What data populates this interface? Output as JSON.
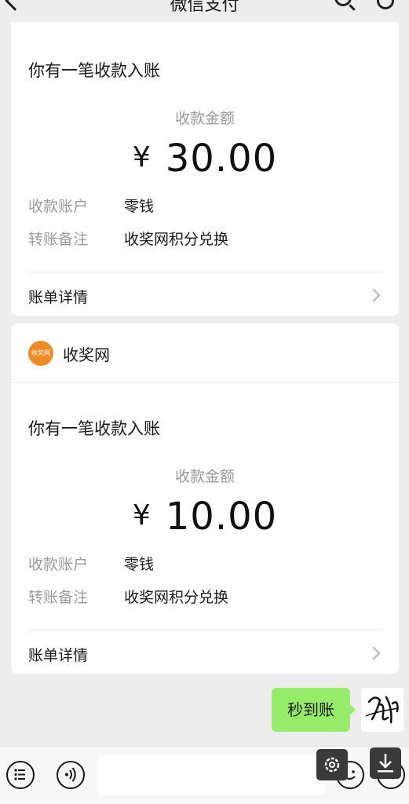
{
  "nav": {
    "title": "微信支付"
  },
  "cards": [
    {
      "notice_title": "你有一笔收款入账",
      "amount_label": "收款金额",
      "currency": "¥",
      "amount": "30.00",
      "account_key": "收款账户",
      "account_value": "零钱",
      "remark_key": "转账备注",
      "remark_value": "收奖网积分兑换",
      "detail_link": "账单详情"
    },
    {
      "source_name": "收奖网",
      "source_logo_text": "收奖网",
      "notice_title": "你有一笔收款入账",
      "amount_label": "收款金额",
      "currency": "¥",
      "amount": "10.00",
      "account_key": "收款账户",
      "account_value": "零钱",
      "remark_key": "转账备注",
      "remark_value": "收奖网积分兑换",
      "detail_link": "账单详情"
    }
  ],
  "chat": {
    "message": "秒到账"
  },
  "colors": {
    "bubble": "#95ec69",
    "logo": "#f08a24",
    "background": "#ededed"
  },
  "icons": [
    "back-icon",
    "search-icon",
    "person-icon",
    "chevron-right-icon",
    "menu-icon",
    "voice-icon",
    "emoji-icon",
    "settings-icon",
    "download-icon"
  ]
}
